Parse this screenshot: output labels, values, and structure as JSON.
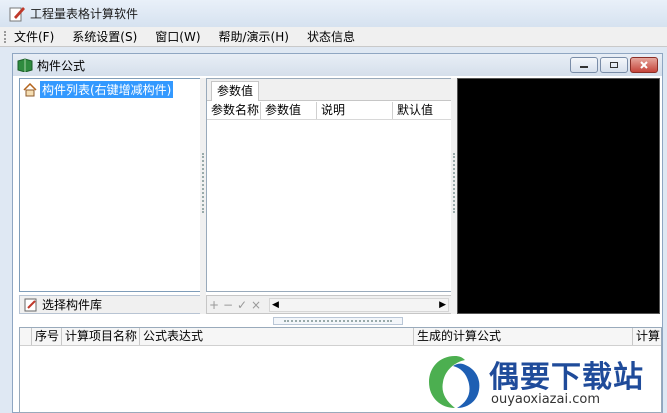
{
  "window": {
    "title": "工程量表格计算软件"
  },
  "menu": {
    "items": [
      "文件(F)",
      "系统设置(S)",
      "窗口(W)",
      "帮助/演示(H)",
      "状态信息"
    ]
  },
  "inner_window": {
    "title": "构件公式"
  },
  "tree": {
    "root_label": "构件列表(右键增减构件)"
  },
  "library": {
    "button_label": "选择构件库"
  },
  "params": {
    "tab_label": "参数值",
    "columns": [
      "参数名称",
      "参数值",
      "说明",
      "默认值"
    ],
    "toolbar": [
      "+",
      "−",
      "✓",
      "×"
    ]
  },
  "grid": {
    "columns": [
      "序号",
      "计算项目名称",
      "公式表达式",
      "生成的计算公式",
      "计算"
    ]
  },
  "watermark": {
    "name": "偶要下载站",
    "url": "ouyaoxiazai.com"
  },
  "colors": {
    "selection": "#3399ff",
    "preview_bg": "#000000",
    "logo_blue": "#1f4b9a"
  }
}
